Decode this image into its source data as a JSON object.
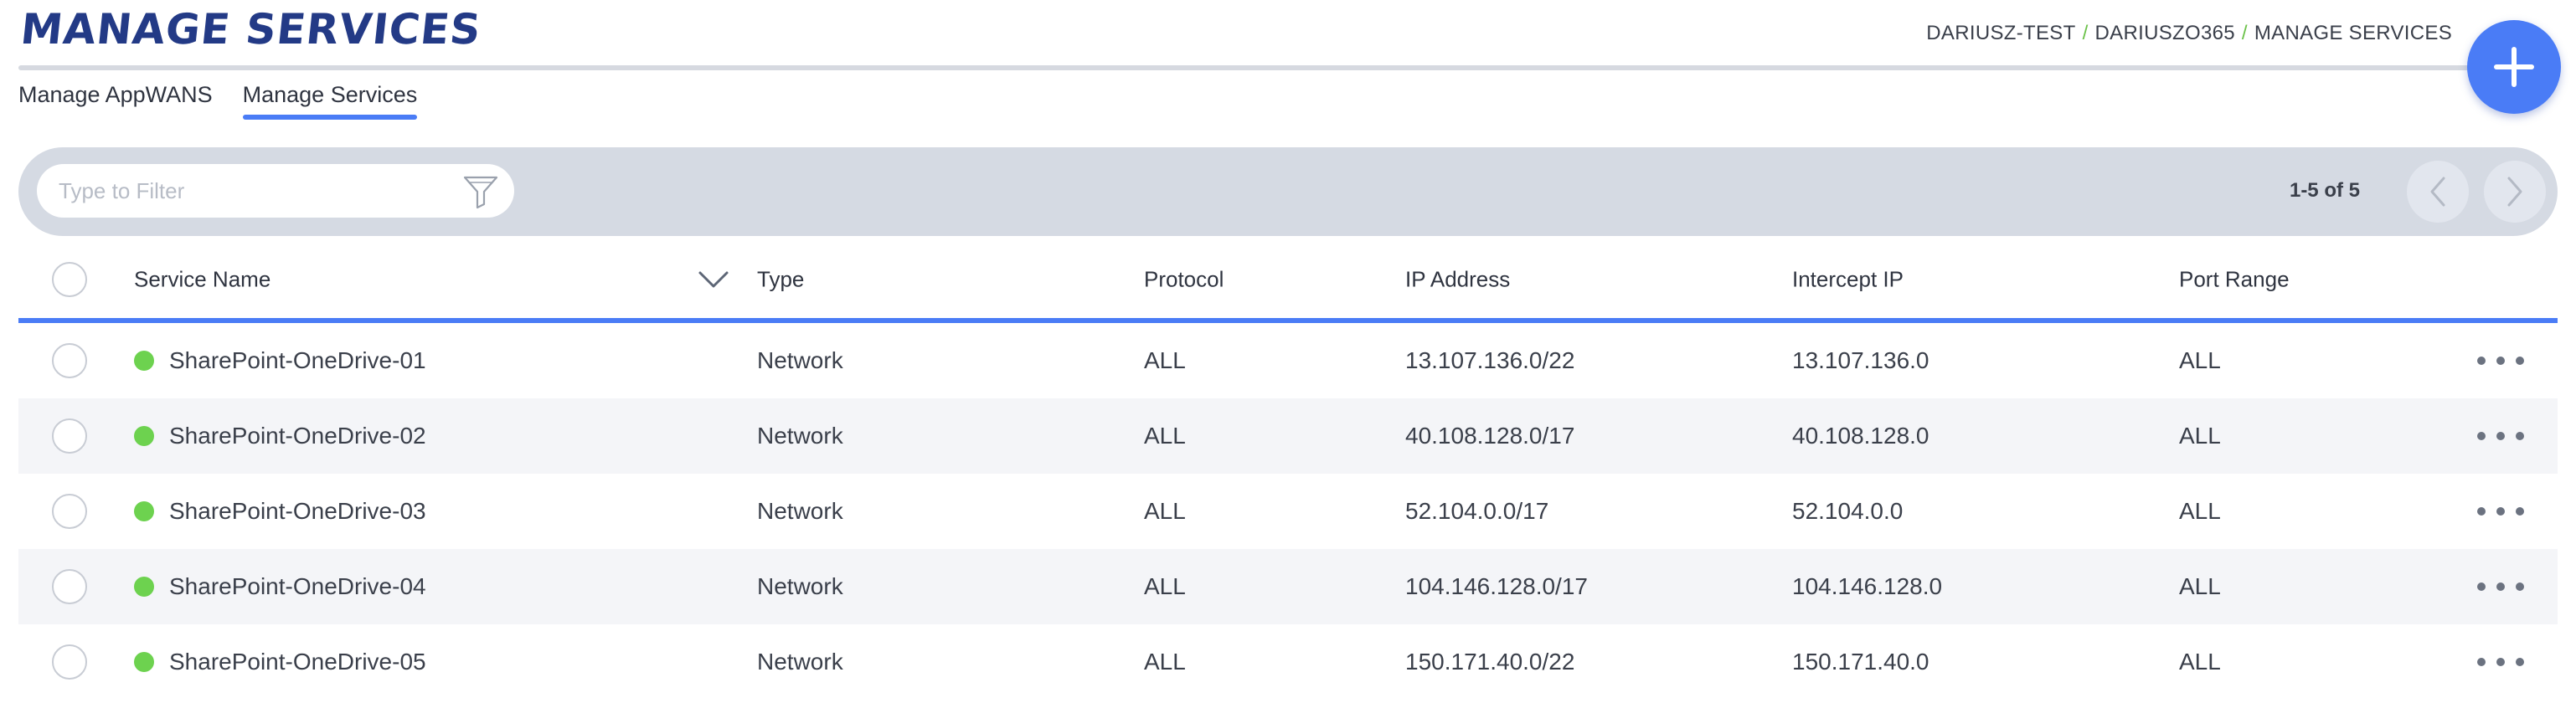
{
  "page": {
    "title": "MANAGE SERVICES"
  },
  "breadcrumb": {
    "items": [
      "DARIUSZ-TEST",
      "DARIUSZO365",
      "MANAGE SERVICES"
    ],
    "separator": "/"
  },
  "tabs": [
    {
      "label": "Manage AppWANS",
      "active": false
    },
    {
      "label": "Manage Services",
      "active": true
    }
  ],
  "filter": {
    "placeholder": "Type to Filter",
    "value": "",
    "icon": "funnel-icon"
  },
  "pagination": {
    "label": "1-5 of 5",
    "prev_icon": "chevron-left-icon",
    "next_icon": "chevron-right-icon"
  },
  "add_button": {
    "icon": "plus-icon"
  },
  "table": {
    "columns": {
      "name": "Service Name",
      "type": "Type",
      "protocol": "Protocol",
      "ip": "IP Address",
      "intercept": "Intercept IP",
      "port": "Port Range"
    },
    "rows": [
      {
        "name": "SharePoint-OneDrive-01",
        "type": "Network",
        "protocol": "ALL",
        "ip": "13.107.136.0/22",
        "intercept": "13.107.136.0",
        "port": "ALL",
        "status": "active"
      },
      {
        "name": "SharePoint-OneDrive-02",
        "type": "Network",
        "protocol": "ALL",
        "ip": "40.108.128.0/17",
        "intercept": "40.108.128.0",
        "port": "ALL",
        "status": "active"
      },
      {
        "name": "SharePoint-OneDrive-03",
        "type": "Network",
        "protocol": "ALL",
        "ip": "52.104.0.0/17",
        "intercept": "52.104.0.0",
        "port": "ALL",
        "status": "active"
      },
      {
        "name": "SharePoint-OneDrive-04",
        "type": "Network",
        "protocol": "ALL",
        "ip": "104.146.128.0/17",
        "intercept": "104.146.128.0",
        "port": "ALL",
        "status": "active"
      },
      {
        "name": "SharePoint-OneDrive-05",
        "type": "Network",
        "protocol": "ALL",
        "ip": "150.171.40.0/22",
        "intercept": "150.171.40.0",
        "port": "ALL",
        "status": "active"
      }
    ]
  },
  "colors": {
    "accent": "#4a7cf6",
    "title": "#233a86",
    "status_active": "#6dd24f",
    "breadcrumb_separator": "#6cc24a"
  }
}
